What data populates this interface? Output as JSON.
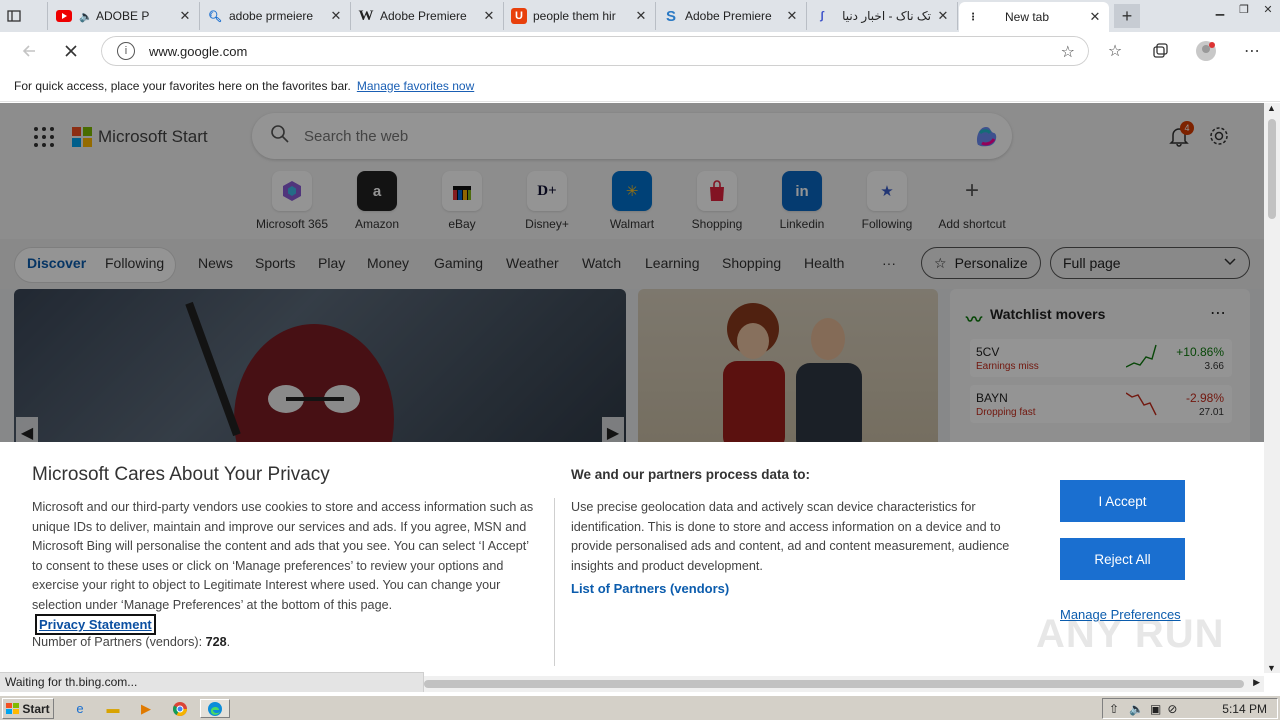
{
  "tabs": [
    {
      "title": "ADOBE P",
      "icon": "youtube-icon"
    },
    {
      "title": "adobe prmeiere",
      "icon": "search-icon"
    },
    {
      "title": "Adobe Premiere",
      "icon": "wikipedia-icon"
    },
    {
      "title": "people them hir",
      "icon": "red-app-icon"
    },
    {
      "title": "Adobe Premiere",
      "icon": "s-logo-icon"
    },
    {
      "title": "تک ناک - اخبار دنیا",
      "icon": "feather-icon"
    },
    {
      "title": "New tab",
      "icon": "newtab-icon"
    }
  ],
  "address": {
    "url": "www.google.com"
  },
  "favbar": {
    "text": "For quick access, place your favorites here on the favorites bar.",
    "link": "Manage favorites now"
  },
  "msn": {
    "brand": "Microsoft Start",
    "search_placeholder": "Search the web",
    "notif_count": "4",
    "shortcuts": [
      "Microsoft 365",
      "Amazon",
      "eBay",
      "Disney+",
      "Walmart",
      "Shopping",
      "Linkedin",
      "Following",
      "Add shortcut"
    ],
    "nav": {
      "discover": "Discover",
      "following": "Following",
      "items": [
        "News",
        "Sports",
        "Play",
        "Money",
        "Gaming",
        "Weather",
        "Watch",
        "Learning",
        "Shopping",
        "Health"
      ],
      "more": "···",
      "personalize": "Personalize",
      "layout": "Full page"
    },
    "watchlist": {
      "title": "Watchlist movers",
      "rows": [
        {
          "symbol": "5CV",
          "note": "Earnings miss",
          "pct": "+10.86%",
          "price": "3.66"
        },
        {
          "symbol": "BAYN",
          "note": "Dropping fast",
          "pct": "-2.98%",
          "price": "27.01"
        }
      ]
    }
  },
  "privacy": {
    "title": "Microsoft Cares About Your Privacy",
    "body": "Microsoft and our third-party vendors use cookies to store and access information such as unique IDs to deliver, maintain and improve our services and ads. If you agree, MSN and Microsoft Bing will personalise the content and ads that you see. You can select ‘I Accept’ to consent to these uses or click on ‘Manage preferences’ to review your options and exercise your right to object to Legitimate Interest where used.  You can change your selection under ‘Manage Preferences’ at the bottom of this page.",
    "statement_link": "Privacy Statement",
    "partners_count_label": "Number of Partners (vendors):",
    "partners_count": "728",
    "process_title": "We and our partners process data to:",
    "process_body": "Use precise geolocation data and actively scan device characteristics for identification. This is done to store and access information on a device and to provide personalised ads and content, ad and content measurement, audience insights and product development.",
    "partners_link": "List of Partners (vendors)",
    "accept": "I Accept",
    "reject": "Reject All",
    "manage": "Manage Preferences",
    "watermark": "ANY RUN"
  },
  "status": {
    "text": "Waiting for th.bing.com..."
  },
  "taskbar": {
    "start": "Start",
    "clock": "5:14 PM"
  },
  "colors": {
    "accent": "#1a6fd0",
    "link": "#0b5cad",
    "positive": "#0f7b0f",
    "negative": "#c42b1c"
  }
}
